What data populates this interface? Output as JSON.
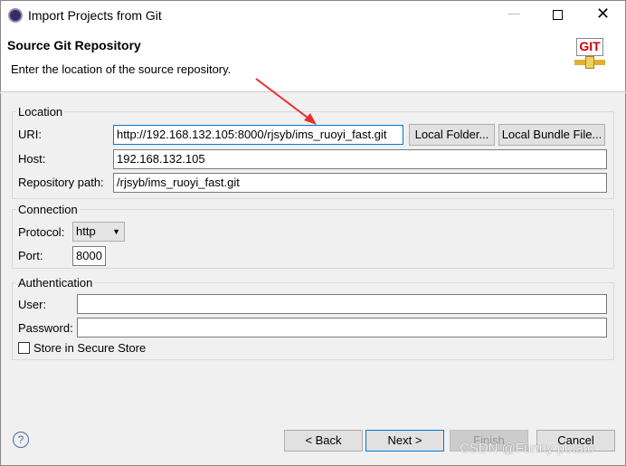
{
  "window": {
    "title": "Import Projects from Git"
  },
  "header": {
    "title": "Source Git Repository",
    "description": "Enter the location of the source repository.",
    "logo_text": "GIT"
  },
  "location": {
    "legend": "Location",
    "uri_label": "URI:",
    "uri_value": "http://192.168.132.105:8000/rjsyb/ims_ruoyi_fast.git",
    "local_folder": "Local Folder...",
    "local_bundle": "Local Bundle File...",
    "host_label": "Host:",
    "host_value": "192.168.132.105",
    "path_label": "Repository path:",
    "path_value": "/rjsyb/ims_ruoyi_fast.git"
  },
  "connection": {
    "legend": "Connection",
    "protocol_label": "Protocol:",
    "protocol_value": "http",
    "port_label": "Port:",
    "port_value": "8000"
  },
  "auth": {
    "legend": "Authentication",
    "user_label": "User:",
    "user_value": "",
    "password_label": "Password:",
    "password_value": "",
    "secure_store_label": "Store in Secure Store",
    "secure_store_checked": false
  },
  "footer": {
    "back": "< Back",
    "next": "Next >",
    "finish": "Finish",
    "cancel": "Cancel"
  },
  "watermark": "CSDN @Funny potato",
  "colors": {
    "arrow": "#e8302a",
    "focus": "#0078d7"
  }
}
